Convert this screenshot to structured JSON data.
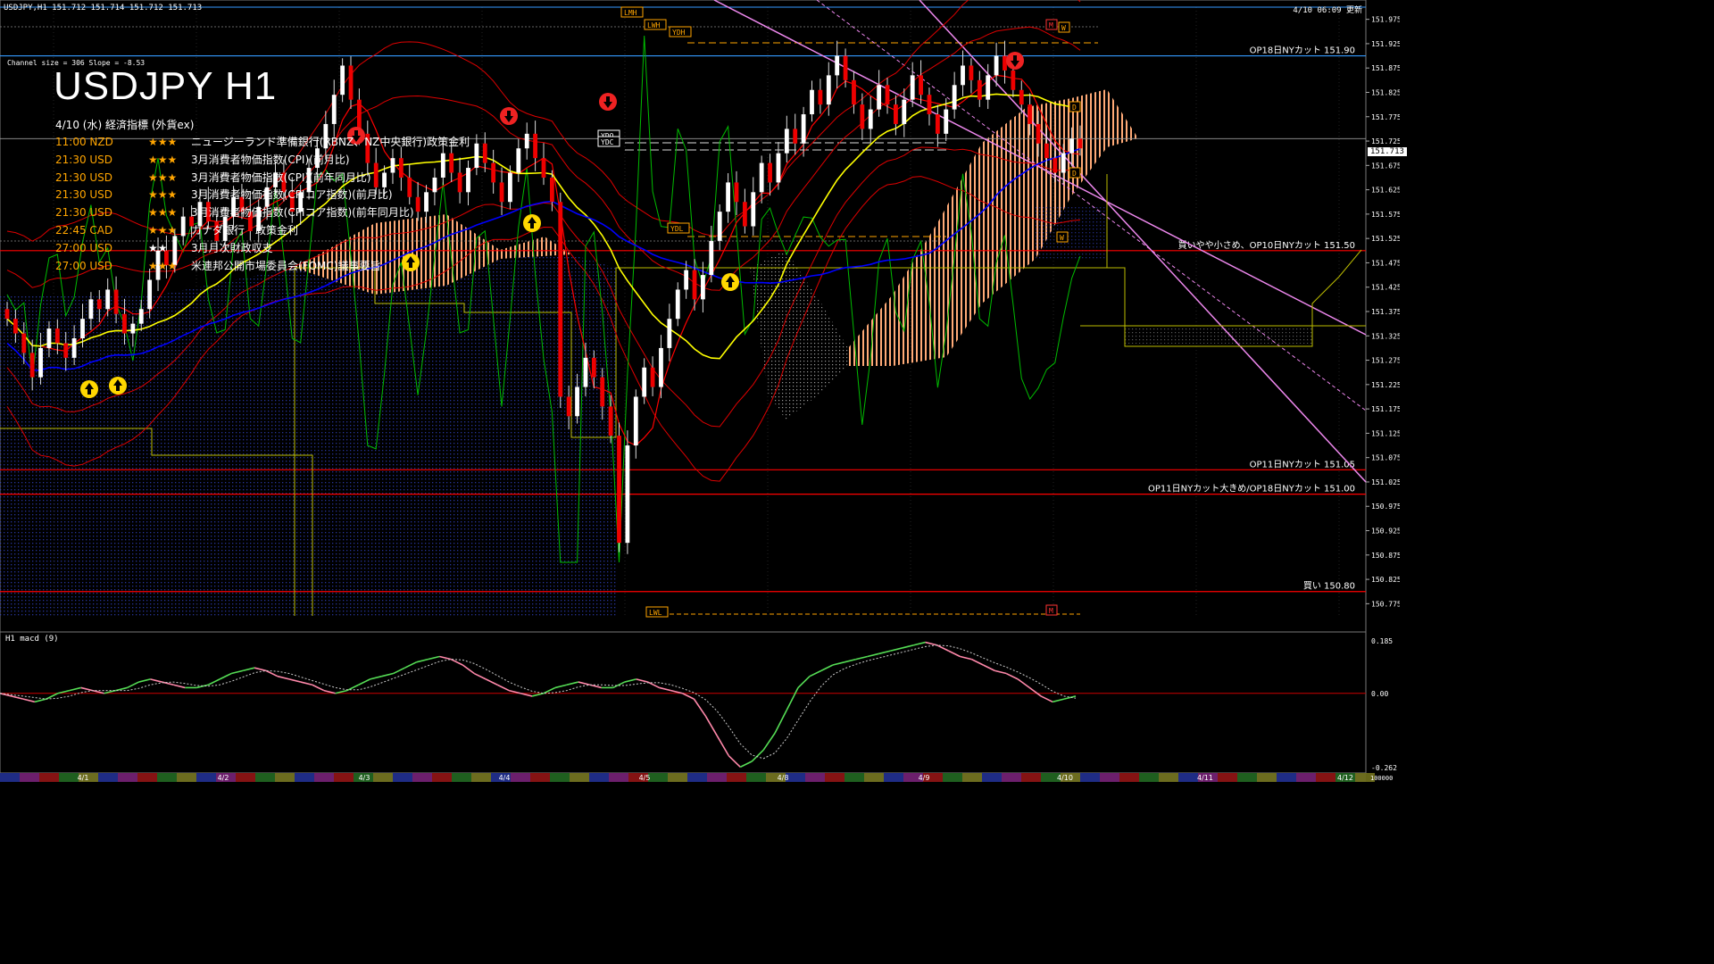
{
  "header": {
    "symbol_bar": "USDJPY,H1  151.712 151.714 151.712 151.713",
    "updated": "4/10 06:09 更新",
    "channel_info": "Channel size = 306 Slope = -8.53"
  },
  "title": "USDJPY H1",
  "econ": {
    "header": "4/10 (水) 経済指標 (外貨ex)",
    "events": [
      {
        "time": "11:00 NZD",
        "stars": "★★★",
        "name": "ニュージーランド準備銀行(RBNZ、NZ中央銀行)政策金利"
      },
      {
        "time": "21:30 USD",
        "stars": "★★★",
        "name": "3月消費者物価指数(CPI)(前月比)"
      },
      {
        "time": "21:30 USD",
        "stars": "★★★",
        "name": "3月消費者物価指数(CPI)(前年同月比)"
      },
      {
        "time": "21:30 USD",
        "stars": "★★★",
        "name": "3月消費者物価指数(CPIコア指数)(前月比)"
      },
      {
        "time": "21:30 USD",
        "stars": "★★★",
        "name": "3月消費者物価指数(CPIコア指数)(前年同月比)"
      },
      {
        "time": "22:45 CAD",
        "stars": "★★★",
        "name": "カナダ銀行　政策金利"
      },
      {
        "time": "27:00 USD",
        "stars": "★★",
        "name": "3月月次財政収支"
      },
      {
        "time": "27:00 USD",
        "stars": "★★★",
        "name": "米連邦公開市場委員会(FOMC)議事要旨"
      }
    ]
  },
  "current_price": "151.713",
  "macd_label": "H1  macd (9)",
  "colors": {
    "background": "#000000",
    "ma_fast": "#FF0000",
    "ma_mid": "#FFFF00",
    "ma_slow": "#0000FF",
    "cloud_up": "#FFAA77",
    "cloud_down": "#3344CC",
    "bollinger": "#DD0000",
    "rsi_line": "#00BB00",
    "channel": "#EE88EE",
    "level_line": "#FF0000",
    "macd_pos": "#55DD55",
    "macd_neg": "#FF88AA"
  },
  "chart_data": {
    "type": "candlestick",
    "symbol": "USDJPY",
    "timeframe": "H1",
    "y_range": [
      150.75,
      152.0
    ],
    "y_ticks": [
      "151.975",
      "151.925",
      "151.875",
      "151.825",
      "151.775",
      "151.725",
      "151.675",
      "151.625",
      "151.575",
      "151.525",
      "151.475",
      "151.425",
      "151.375",
      "151.325",
      "151.275",
      "151.225",
      "151.175",
      "151.125",
      "151.075",
      "151.025",
      "150.975",
      "150.925",
      "150.875",
      "150.825",
      "150.775"
    ],
    "x_ticks": [
      "4/1",
      "4/2",
      "4/3",
      "4/4",
      "4/5",
      "4/8",
      "4/9",
      "4/10",
      "4/11",
      "4/12"
    ],
    "levels": [
      {
        "label": "OP18日NYカット 151.90",
        "value": 151.9,
        "color": "#3399FF"
      },
      {
        "label": "買いやや小さめ、OP10日NYカット 151.50",
        "value": 151.5,
        "color": "#FF0000"
      },
      {
        "label": "OP11日NYカット 151.05",
        "value": 151.05,
        "color": "#FF0000"
      },
      {
        "label": "OP11日NYカット大きめ/OP18日NYカット 151.00",
        "value": 151.0,
        "color": "#FF0000"
      },
      {
        "label": "買い 150.80",
        "value": 150.8,
        "color": "#FF0000"
      }
    ],
    "boxes": [
      {
        "label": "LWH",
        "value": 151.95
      },
      {
        "label": "YDH",
        "value": 151.93
      },
      {
        "label": "YDO",
        "value": 151.74
      },
      {
        "label": "YDC",
        "value": 151.72
      },
      {
        "label": "YDL",
        "value": 151.56
      },
      {
        "label": "LWL",
        "value": 150.8
      },
      {
        "label": "LMH",
        "value": 151.98
      },
      {
        "label": "M",
        "value": 151.96
      },
      {
        "label": "W",
        "value": 151.94
      },
      {
        "label": "D",
        "value": 151.77
      },
      {
        "label": "D",
        "value": 151.65
      },
      {
        "label": "W",
        "value": 151.53
      },
      {
        "label": "M",
        "value": 150.8
      }
    ],
    "closes": [
      151.36,
      151.33,
      151.29,
      151.24,
      151.3,
      151.34,
      151.31,
      151.28,
      151.32,
      151.36,
      151.4,
      151.38,
      151.42,
      151.37,
      151.33,
      151.35,
      151.38,
      151.44,
      151.5,
      151.47,
      151.53,
      151.57,
      151.55,
      151.6,
      151.56,
      151.52,
      151.57,
      151.61,
      151.58,
      151.54,
      151.59,
      151.63,
      151.66,
      151.62,
      151.58,
      151.62,
      151.67,
      151.71,
      151.76,
      151.82,
      151.88,
      151.81,
      151.74,
      151.68,
      151.63,
      151.66,
      151.69,
      151.65,
      151.61,
      151.58,
      151.62,
      151.65,
      151.7,
      151.66,
      151.62,
      151.67,
      151.72,
      151.68,
      151.64,
      151.6,
      151.66,
      151.71,
      151.74,
      151.69,
      151.65,
      151.6,
      151.2,
      151.16,
      151.22,
      151.28,
      151.24,
      151.18,
      151.12,
      150.9,
      151.1,
      151.2,
      151.26,
      151.22,
      151.3,
      151.36,
      151.42,
      151.46,
      151.4,
      151.45,
      151.52,
      151.58,
      151.64,
      151.6,
      151.55,
      151.62,
      151.68,
      151.64,
      151.7,
      151.75,
      151.72,
      151.78,
      151.83,
      151.8,
      151.86,
      151.9,
      151.85,
      151.8,
      151.75,
      151.79,
      151.84,
      151.8,
      151.76,
      151.81,
      151.86,
      151.82,
      151.78,
      151.74,
      151.79,
      151.84,
      151.88,
      151.85,
      151.81,
      151.86,
      151.9,
      151.87,
      151.83,
      151.8,
      151.76,
      151.72,
      151.69,
      151.66,
      151.7,
      151.73,
      151.71
    ],
    "macd": [
      0.0,
      -0.01,
      -0.02,
      -0.03,
      -0.02,
      0.0,
      0.01,
      0.02,
      0.01,
      0.0,
      0.01,
      0.02,
      0.04,
      0.05,
      0.04,
      0.03,
      0.02,
      0.02,
      0.03,
      0.05,
      0.07,
      0.08,
      0.09,
      0.08,
      0.06,
      0.05,
      0.04,
      0.03,
      0.01,
      0.0,
      0.01,
      0.03,
      0.05,
      0.06,
      0.07,
      0.09,
      0.11,
      0.12,
      0.13,
      0.12,
      0.1,
      0.07,
      0.05,
      0.03,
      0.01,
      0.0,
      -0.01,
      0.0,
      0.02,
      0.03,
      0.04,
      0.03,
      0.02,
      0.02,
      0.04,
      0.05,
      0.04,
      0.02,
      0.01,
      0.0,
      -0.02,
      -0.08,
      -0.15,
      -0.22,
      -0.26,
      -0.24,
      -0.2,
      -0.14,
      -0.06,
      0.02,
      0.06,
      0.08,
      0.1,
      0.11,
      0.12,
      0.13,
      0.14,
      0.15,
      0.16,
      0.17,
      0.18,
      0.17,
      0.15,
      0.13,
      0.12,
      0.1,
      0.08,
      0.07,
      0.05,
      0.02,
      -0.01,
      -0.03,
      -0.02,
      -0.01
    ],
    "macd_scale": [
      "0.185",
      "0.00",
      "-0.262"
    ],
    "x_axis_bottom": "100000"
  }
}
